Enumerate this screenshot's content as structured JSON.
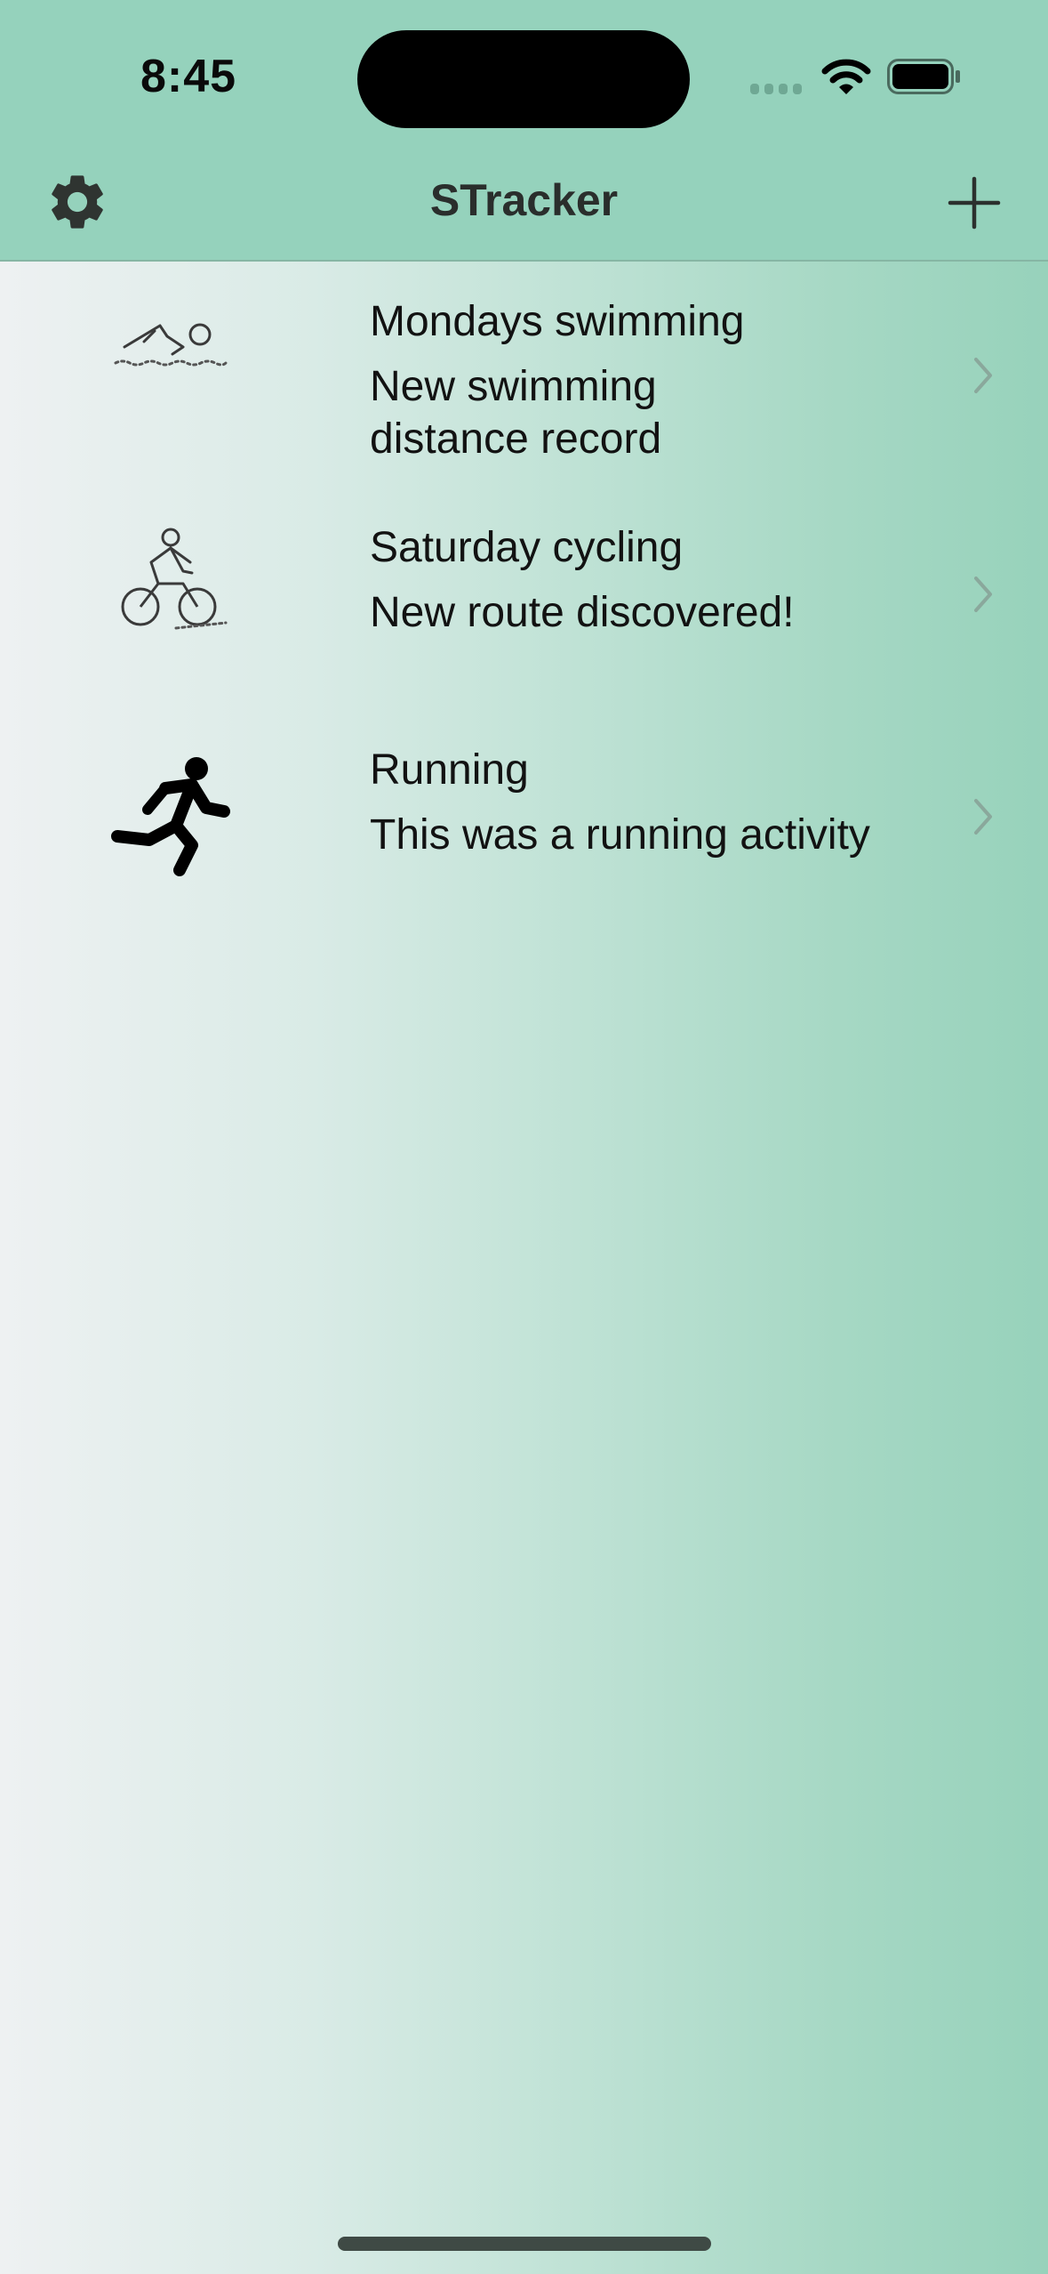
{
  "status_bar": {
    "time": "8:45"
  },
  "nav": {
    "title": "STracker",
    "left_icon": "gear-icon",
    "right_icon": "plus-icon"
  },
  "activities": [
    {
      "icon": "swimming-icon",
      "title": "Mondays swimming",
      "subtitle": "New swimming\ndistance record"
    },
    {
      "icon": "cycling-icon",
      "title": "Saturday cycling",
      "subtitle": "New route discovered!"
    },
    {
      "icon": "running-icon",
      "title": "Running",
      "subtitle": "This was a running activity"
    }
  ],
  "colors": {
    "header_bg": "#95d2bc",
    "gradient_start": "#eef1f2",
    "gradient_end": "#97d2bb"
  }
}
